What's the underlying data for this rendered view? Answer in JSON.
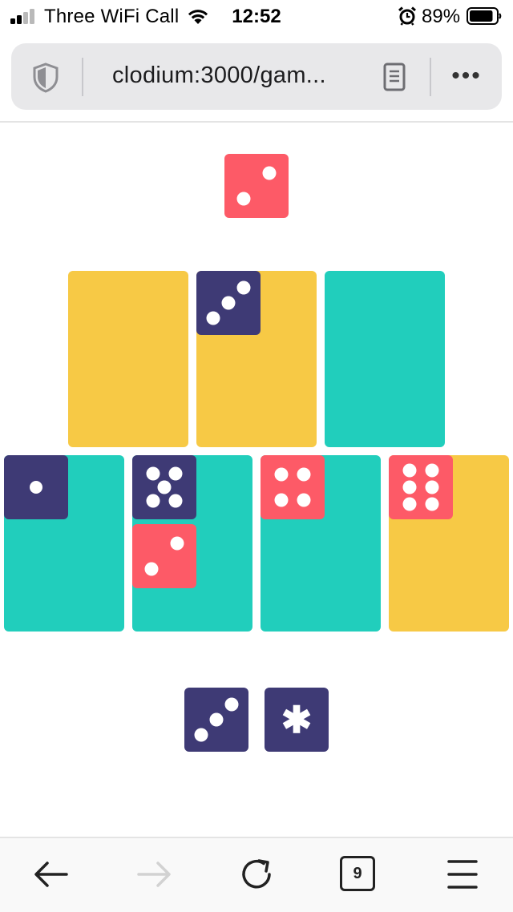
{
  "status_bar": {
    "carrier": "Three WiFi Call",
    "time": "12:52",
    "battery_percent": "89%",
    "battery_level": 0.89,
    "signal_bars": 2,
    "icons": [
      "signal-icon",
      "wifi-icon",
      "alarm-icon",
      "battery-icon"
    ]
  },
  "browser": {
    "url": "clodium:3000/gam...",
    "icons": [
      "shield-icon",
      "reader-view-icon",
      "more-icon"
    ],
    "more_label": "•••"
  },
  "colors": {
    "red": "#fd5a67",
    "navy": "#3e3a75",
    "yellow": "#f7c945",
    "teal": "#21cebc",
    "pip": "#ffffff"
  },
  "game": {
    "top_die": {
      "color": "red",
      "value": 2
    },
    "upper_row": [
      {
        "color": "yellow",
        "dice": []
      },
      {
        "color": "yellow",
        "dice": [
          {
            "color": "navy",
            "value": 3
          }
        ]
      },
      {
        "color": "teal",
        "dice": []
      }
    ],
    "lower_row": [
      {
        "color": "teal",
        "dice": [
          {
            "color": "navy",
            "value": 1
          }
        ]
      },
      {
        "color": "teal",
        "dice": [
          {
            "color": "navy",
            "value": 5
          },
          {
            "color": "red",
            "value": 2
          }
        ]
      },
      {
        "color": "teal",
        "dice": [
          {
            "color": "red",
            "value": 4
          }
        ]
      },
      {
        "color": "yellow",
        "dice": [
          {
            "color": "red",
            "value": 6
          }
        ]
      }
    ],
    "hand": [
      {
        "color": "navy",
        "value": 3
      },
      {
        "color": "navy",
        "symbol": "✱"
      }
    ]
  },
  "toolbar": {
    "tab_count": "9",
    "icons": [
      "back-icon",
      "forward-icon",
      "reload-icon",
      "tabs-icon",
      "menu-icon"
    ]
  }
}
